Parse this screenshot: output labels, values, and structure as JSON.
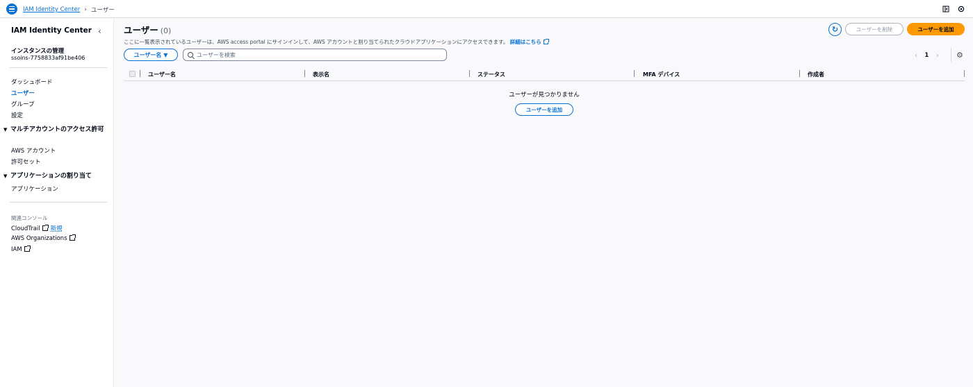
{
  "breadcrumb": {
    "service": "IAM Identity Center",
    "current": "ユーザー"
  },
  "sidebar": {
    "title": "IAM Identity Center",
    "instance_label": "インスタンスの管理",
    "instance_id": "ssoins-7758833af91be406",
    "items": [
      {
        "label": "ダッシュボード"
      },
      {
        "label": "ユーザー"
      },
      {
        "label": "グループ"
      },
      {
        "label": "設定"
      }
    ],
    "sections": [
      {
        "title": "マルチアカウントのアクセス許可",
        "items": [
          "AWS アカウント",
          "許可セット"
        ]
      },
      {
        "title": "アプリケーションの割り当て",
        "items": [
          "アプリケーション"
        ]
      }
    ],
    "related_label": "関連コンソール",
    "related": [
      {
        "label": "CloudTrail",
        "tag": "新規"
      },
      {
        "label": "AWS Organizations"
      },
      {
        "label": "IAM"
      }
    ]
  },
  "main": {
    "title": "ユーザー",
    "count": "(0)",
    "description": "ここに一覧表示されているユーザーは、AWS access portal にサインインして、AWS アカウントと割り当てられたクラウドアプリケーションにアクセスできます。",
    "learn_more": "詳細はこちら",
    "delete_button": "ユーザーを削除",
    "add_button": "ユーザーを追加",
    "filter_button": "ユーザー名",
    "search_placeholder": "ユーザーを検索",
    "page": "1",
    "columns": [
      "ユーザー名",
      "表示名",
      "ステータス",
      "MFA デバイス",
      "作成者"
    ],
    "empty_message": "ユーザーが見つかりません",
    "empty_add_button": "ユーザーを追加"
  },
  "colors": {
    "accent": "#0972d3",
    "primary_button": "#ff9900"
  }
}
